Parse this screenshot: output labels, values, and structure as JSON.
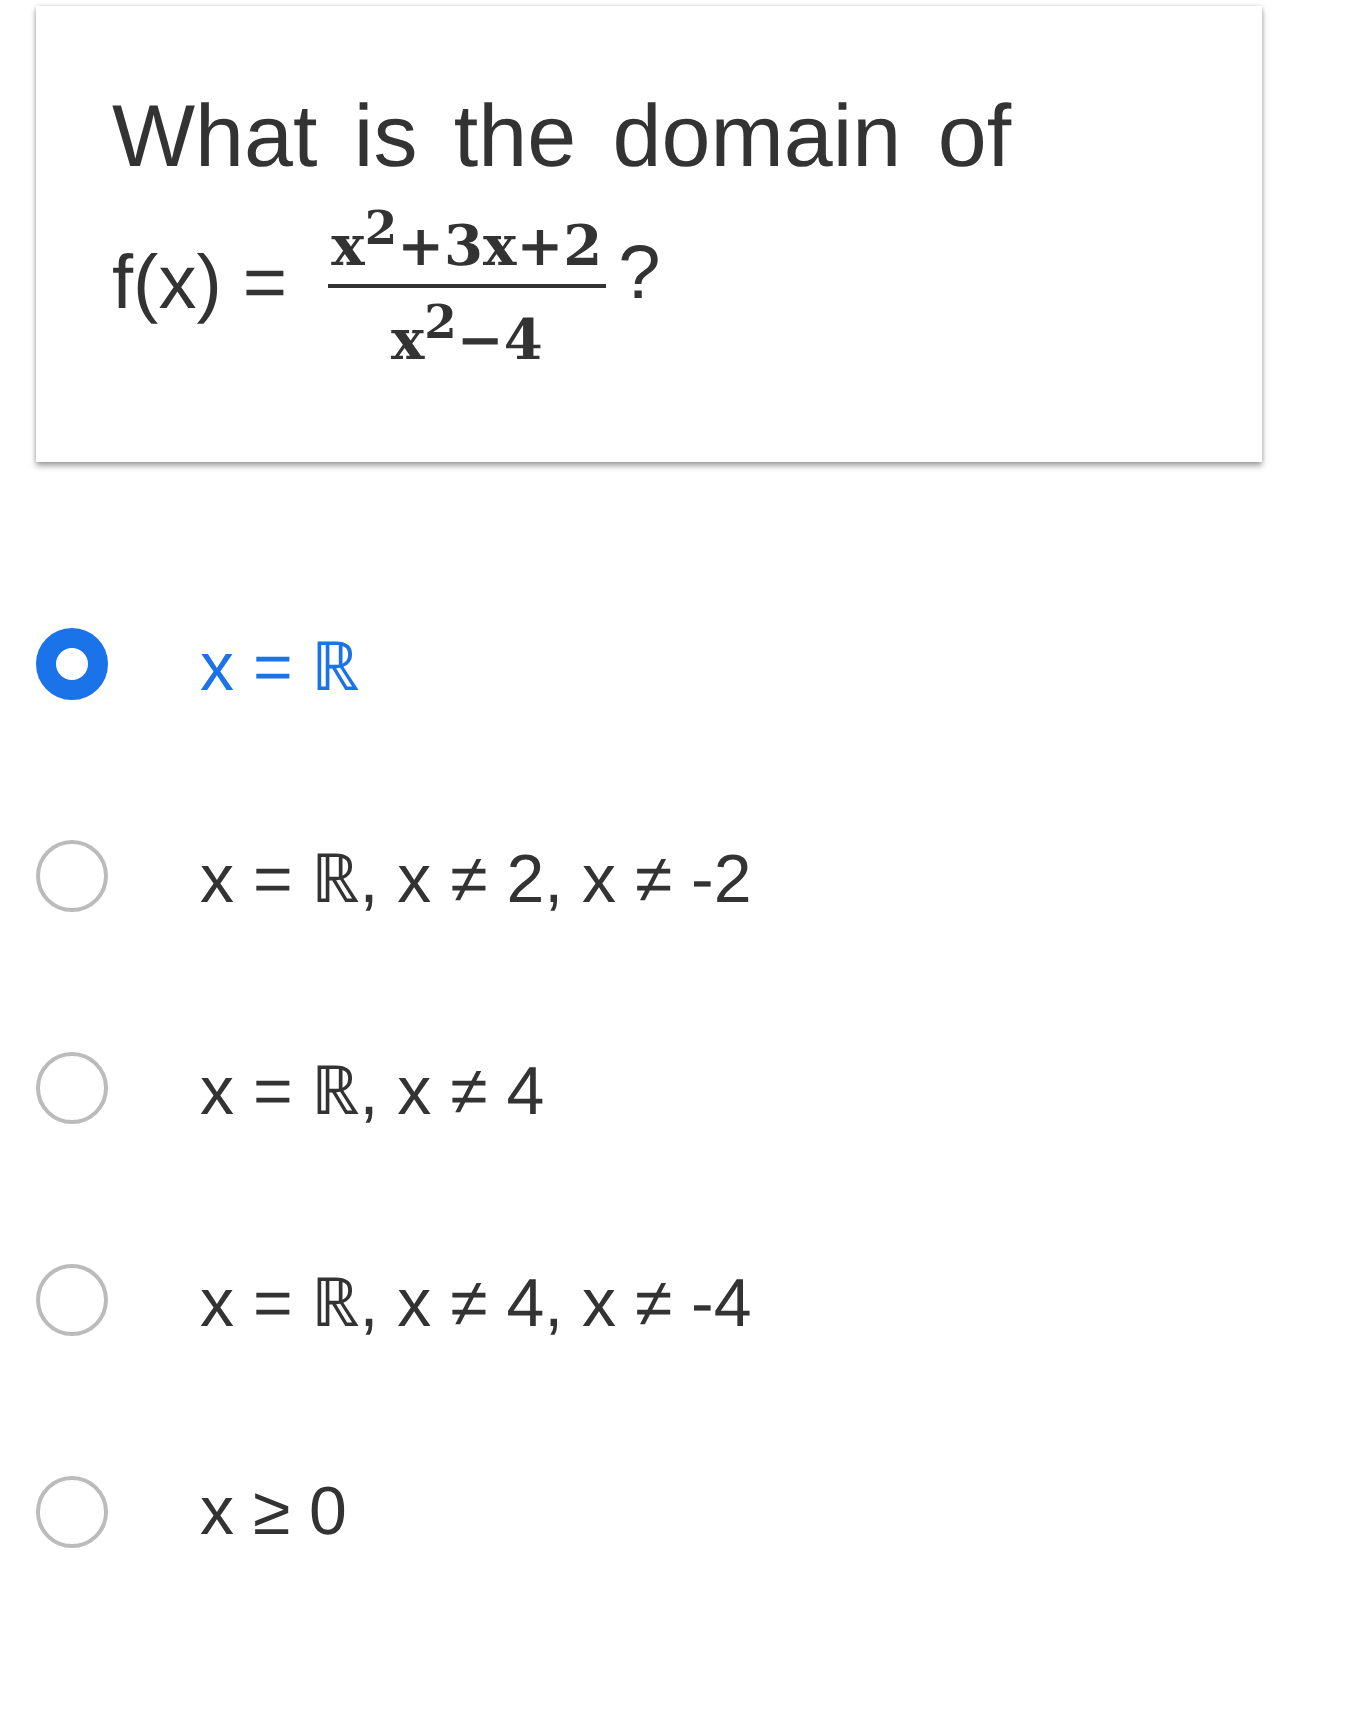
{
  "question": {
    "text": "What is the domain of",
    "function_label": "f(x) =",
    "numerator": "x$^{2}$+3x+2",
    "denominator": "x$^{2}$−4",
    "end_mark": "?"
  },
  "options": [
    {
      "label": "x = ℝ",
      "selected": true
    },
    {
      "label": "x = ℝ, x ≠ 2, x ≠ -2",
      "selected": false
    },
    {
      "label": "x = ℝ, x ≠ 4",
      "selected": false
    },
    {
      "label": "x = ℝ, x ≠ 4, x ≠ -4",
      "selected": false
    },
    {
      "label": "x ≥ 0",
      "selected": false
    }
  ]
}
